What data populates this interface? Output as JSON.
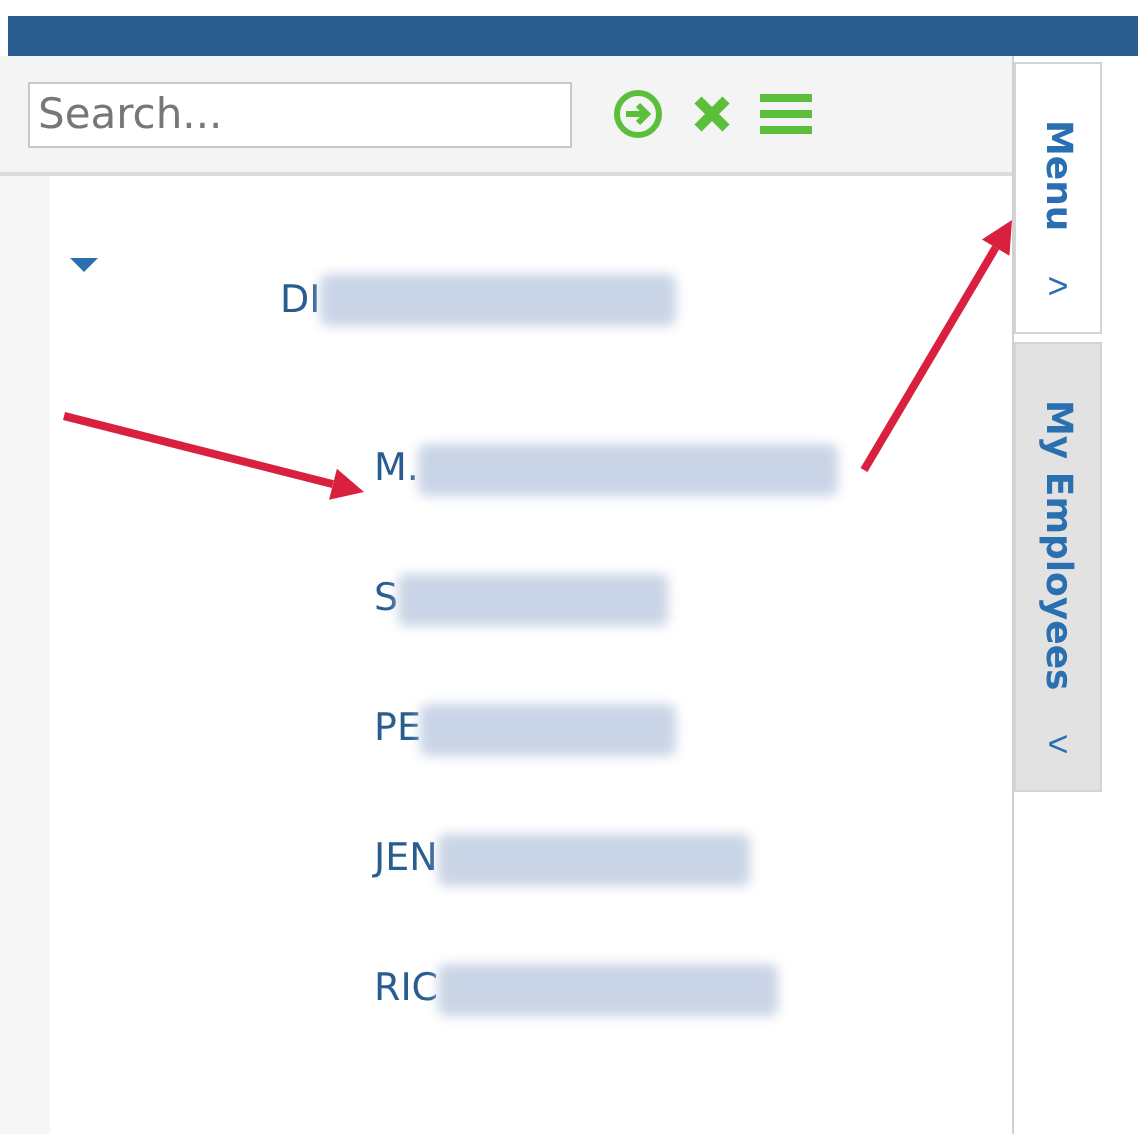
{
  "search": {
    "placeholder": "Search..."
  },
  "tree": [
    {
      "label": "DI",
      "expanded": true,
      "children": [
        {
          "label": "M."
        },
        {
          "label": "S"
        },
        {
          "label": "PE"
        },
        {
          "label": "JEN"
        },
        {
          "label": "RIC"
        }
      ]
    }
  ],
  "side_tabs": [
    {
      "label": "Menu",
      "selected": true,
      "chevron": ">"
    },
    {
      "label": "My Employees",
      "selected": false,
      "chevron": "<"
    }
  ]
}
